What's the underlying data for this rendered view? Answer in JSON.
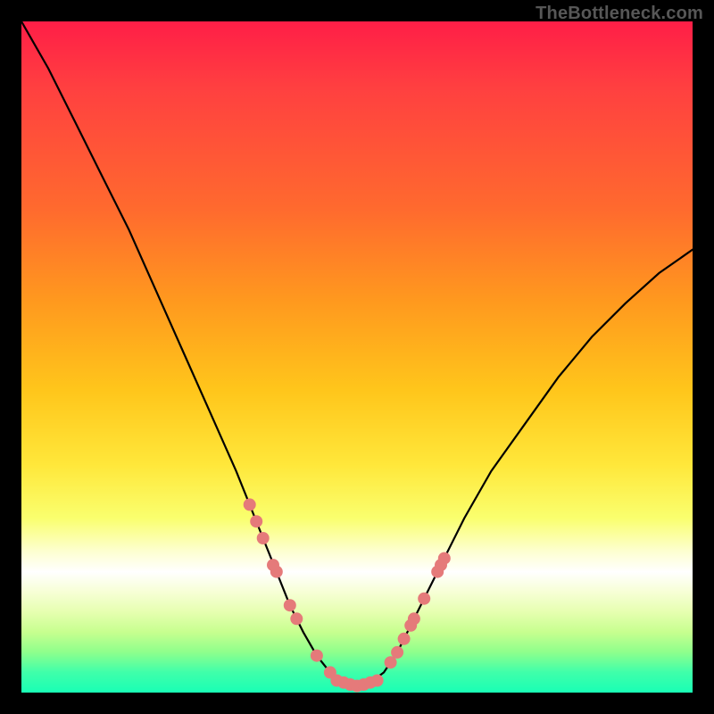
{
  "watermark": "TheBottleneck.com",
  "chart_data": {
    "type": "line",
    "title": "",
    "xlabel": "",
    "ylabel": "",
    "xlim": [
      0,
      100
    ],
    "ylim": [
      0,
      100
    ],
    "curve": {
      "x": [
        0,
        4,
        8,
        12,
        16,
        20,
        24,
        28,
        32,
        34,
        36,
        38,
        40,
        42,
        44,
        46,
        48,
        50,
        52,
        54,
        56,
        58,
        62,
        66,
        70,
        75,
        80,
        85,
        90,
        95,
        100
      ],
      "y": [
        100,
        93,
        85,
        77,
        69,
        60,
        51,
        42,
        33,
        28,
        23,
        18,
        13,
        9,
        5.5,
        3,
        1.5,
        1,
        1.5,
        3,
        6,
        10,
        18,
        26,
        33,
        40,
        47,
        53,
        58,
        62.5,
        66
      ]
    },
    "markers": {
      "left_cluster": [
        {
          "x": 34,
          "y": 28
        },
        {
          "x": 35,
          "y": 25.5
        },
        {
          "x": 36,
          "y": 23
        },
        {
          "x": 37.5,
          "y": 19
        },
        {
          "x": 38,
          "y": 18
        },
        {
          "x": 40,
          "y": 13
        },
        {
          "x": 41,
          "y": 11
        },
        {
          "x": 44,
          "y": 5.5
        },
        {
          "x": 46,
          "y": 3
        }
      ],
      "bottom_cluster": [
        {
          "x": 47,
          "y": 1.8
        },
        {
          "x": 48,
          "y": 1.5
        },
        {
          "x": 49,
          "y": 1.2
        },
        {
          "x": 50,
          "y": 1
        },
        {
          "x": 51,
          "y": 1.2
        },
        {
          "x": 52,
          "y": 1.5
        },
        {
          "x": 53,
          "y": 1.8
        }
      ],
      "right_cluster": [
        {
          "x": 55,
          "y": 4.5
        },
        {
          "x": 56,
          "y": 6
        },
        {
          "x": 57,
          "y": 8
        },
        {
          "x": 58,
          "y": 10
        },
        {
          "x": 58.5,
          "y": 11
        },
        {
          "x": 60,
          "y": 14
        },
        {
          "x": 62,
          "y": 18
        },
        {
          "x": 62.5,
          "y": 19
        },
        {
          "x": 63,
          "y": 20
        }
      ]
    },
    "colors": {
      "curve": "#000000",
      "marker": "#e57a7a"
    }
  }
}
